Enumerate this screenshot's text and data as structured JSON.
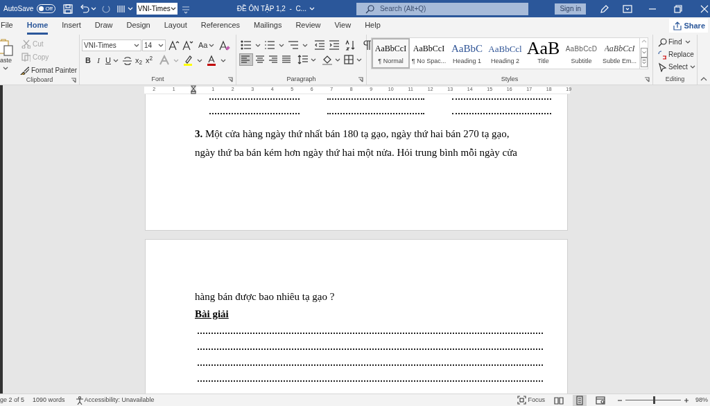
{
  "title_bar": {
    "autosave_label": "AutoSave",
    "autosave_toggle": {
      "label": "Off",
      "on": false
    },
    "font_box": "VNI-Times",
    "document_title": "ĐỀ ÔN TẬP 1,2  -  C...",
    "search": {
      "placeholder": "Search (Alt+Q)"
    },
    "sign_in": "Sign in"
  },
  "tabs": [
    {
      "label": "File",
      "selected": false
    },
    {
      "label": "Home",
      "selected": true
    },
    {
      "label": "Insert",
      "selected": false
    },
    {
      "label": "Draw",
      "selected": false
    },
    {
      "label": "Design",
      "selected": false
    },
    {
      "label": "Layout",
      "selected": false
    },
    {
      "label": "References",
      "selected": false
    },
    {
      "label": "Mailings",
      "selected": false
    },
    {
      "label": "Review",
      "selected": false
    },
    {
      "label": "View",
      "selected": false
    },
    {
      "label": "Help",
      "selected": false
    }
  ],
  "share": "Share",
  "clipboard": {
    "label": "Clipboard",
    "paste": "aste",
    "items": [
      {
        "label": "Cut",
        "disabled": true
      },
      {
        "label": "Copy",
        "disabled": true
      },
      {
        "label": "Format Painter",
        "disabled": false
      }
    ]
  },
  "font": {
    "label": "Font",
    "font_name": "VNI-Times",
    "font_size": "14",
    "change_case": "Aa",
    "bold": "B",
    "italic": "I",
    "underline": "U",
    "subscript": "x$_{2}$",
    "superscript": "x$^{2}$"
  },
  "paragraph": {
    "label": "Paragraph"
  },
  "styles": {
    "label": "Styles",
    "items": [
      {
        "preview": "AaBbCcI",
        "name": "¶ Normal",
        "kind": "normal",
        "selected": true
      },
      {
        "preview": "AaBbCcI",
        "name": "¶ No Spac...",
        "kind": "normal",
        "selected": false
      },
      {
        "preview": "AaBbC",
        "name": "Heading 1",
        "kind": "heading1",
        "selected": false
      },
      {
        "preview": "AaBbCcl",
        "name": "Heading 2",
        "kind": "heading2",
        "selected": false
      },
      {
        "preview": "AaB",
        "name": "Title",
        "kind": "title",
        "selected": false
      },
      {
        "preview": "AaBbCcD",
        "name": "Subtitle",
        "kind": "subtitle",
        "selected": false
      },
      {
        "preview": "AaBbCcI",
        "name": "Subtle Em...",
        "kind": "emphasis",
        "selected": false
      }
    ]
  },
  "editing": {
    "label": "Editing",
    "find": "Find",
    "replace": "Replace",
    "select": "Select"
  },
  "ruler": [
    "2",
    "1",
    "1",
    "2",
    "3",
    "4",
    "5",
    "6",
    "7",
    "8",
    "9",
    "10",
    "11",
    "12",
    "13",
    "14",
    "15",
    "16",
    "17",
    "18",
    "19"
  ],
  "pages": [
    {
      "lines": [
        "**3.** Một cửa hàng ngày thứ nhất bán 180 tạ gạo, ngày thứ hai bán 270 tạ gạo,",
        "ngày thứ ba bán kém hơn ngày thứ hai một nửa. Hỏi trung bình mỗi ngày cửa"
      ]
    },
    {
      "lines": [
        "hàng bán được bao nhiêu tạ gạo ?"
      ],
      "heading": "Bài giải"
    }
  ],
  "status_bar": {
    "page": "ge 2 of 5",
    "words": "1090 words",
    "accessibility": "Accessibility: Unavailable",
    "focus": "Focus",
    "views": [
      {
        "kind": "read",
        "selected": false
      },
      {
        "kind": "print",
        "selected": true
      },
      {
        "kind": "web",
        "selected": false
      }
    ],
    "zoom": {
      "level": 0.51
    },
    "zoom_percent": "98%"
  }
}
